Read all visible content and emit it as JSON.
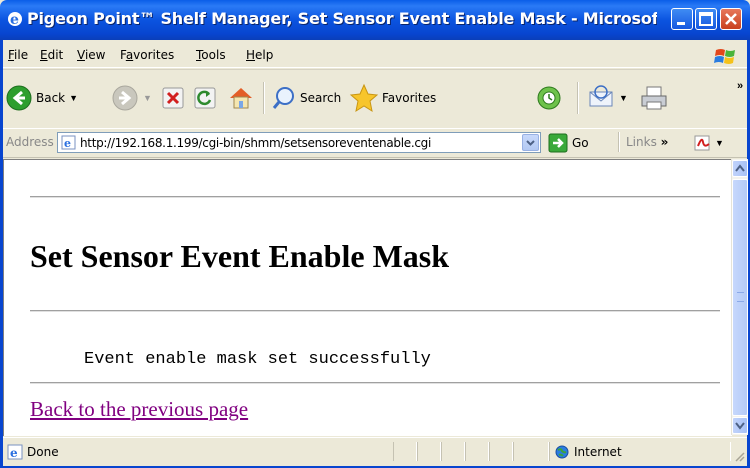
{
  "window": {
    "title": "Pigeon Point™ Shelf Manager, Set Sensor Event Enable Mask - Microsoft I..."
  },
  "menu": {
    "items": [
      {
        "label": "File",
        "accel": "F",
        "rest": "ile"
      },
      {
        "label": "Edit",
        "accel": "E",
        "rest": "dit"
      },
      {
        "label": "View",
        "accel": "V",
        "rest": "iew"
      },
      {
        "label": "Favorites",
        "pre": "F",
        "accel": "a",
        "rest": "vorites"
      },
      {
        "label": "Tools",
        "accel": "T",
        "rest": "ools"
      },
      {
        "label": "Help",
        "accel": "H",
        "rest": "elp"
      }
    ]
  },
  "toolbar": {
    "back_label": "Back",
    "search_label": "Search",
    "favorites_label": "Favorites"
  },
  "address": {
    "label": "Address",
    "url": "http://192.168.1.199/cgi-bin/shmm/setsensoreventenable.cgi",
    "go_label": "Go",
    "links_label": "Links"
  },
  "page": {
    "heading": "Set Sensor Event Enable Mask",
    "message": "Event enable mask set successfully",
    "back_link": "Back to the previous page"
  },
  "status": {
    "text": "Done",
    "zone": "Internet"
  },
  "colors": {
    "titlebar": "#0b54e0",
    "visited_link": "#800080"
  }
}
